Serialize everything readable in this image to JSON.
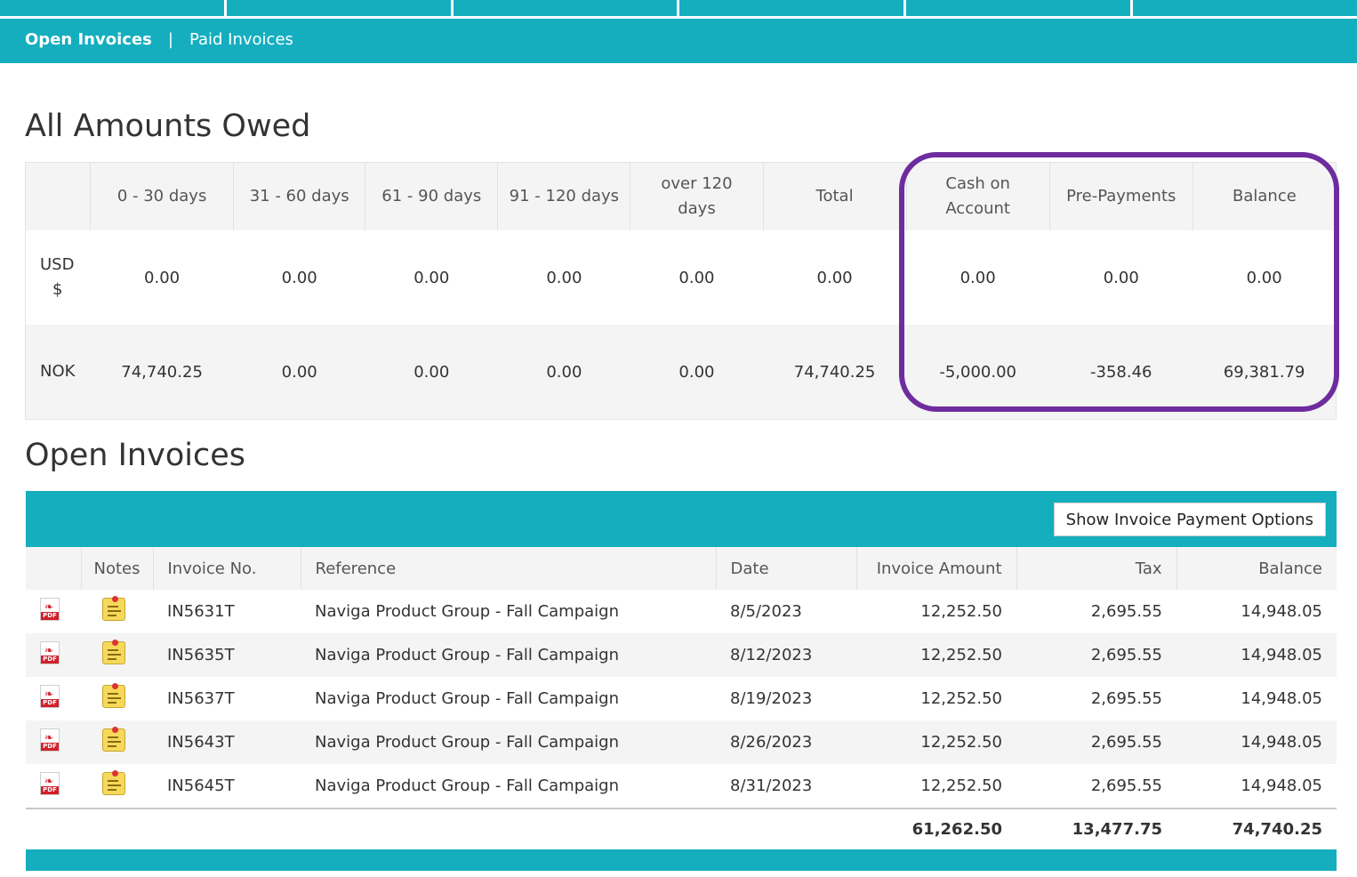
{
  "subnav": {
    "open_label": "Open Invoices",
    "separator": "|",
    "paid_label": "Paid Invoices"
  },
  "aging": {
    "title": "All Amounts Owed",
    "headers": [
      "",
      "0 - 30 days",
      "31 - 60 days",
      "61 - 90 days",
      "91 - 120 days",
      "over 120 days",
      "Total",
      "Cash on Account",
      "Pre-Payments",
      "Balance"
    ],
    "rows": [
      {
        "currency_line1": "USD",
        "currency_line2": "$",
        "values": [
          "0.00",
          "0.00",
          "0.00",
          "0.00",
          "0.00",
          "0.00",
          "0.00",
          "0.00",
          "0.00"
        ]
      },
      {
        "currency_line1": "NOK",
        "currency_line2": "",
        "values": [
          "74,740.25",
          "0.00",
          "0.00",
          "0.00",
          "0.00",
          "74,740.25",
          "-5,000.00",
          "-358.46",
          "69,381.79"
        ]
      }
    ],
    "highlight_color": "#6e2c9e"
  },
  "invoices": {
    "title": "Open Invoices",
    "payment_button": "Show Invoice Payment Options",
    "headers": {
      "icon": "",
      "notes": "Notes",
      "invoice_no": "Invoice No.",
      "reference": "Reference",
      "date": "Date",
      "amount": "Invoice Amount",
      "tax": "Tax",
      "balance": "Balance"
    },
    "rows": [
      {
        "invoice_no": "IN5631T",
        "reference": "Naviga Product Group - Fall Campaign",
        "date": "8/5/2023",
        "amount": "12,252.50",
        "tax": "2,695.55",
        "balance": "14,948.05"
      },
      {
        "invoice_no": "IN5635T",
        "reference": "Naviga Product Group - Fall Campaign",
        "date": "8/12/2023",
        "amount": "12,252.50",
        "tax": "2,695.55",
        "balance": "14,948.05"
      },
      {
        "invoice_no": "IN5637T",
        "reference": "Naviga Product Group - Fall Campaign",
        "date": "8/19/2023",
        "amount": "12,252.50",
        "tax": "2,695.55",
        "balance": "14,948.05"
      },
      {
        "invoice_no": "IN5643T",
        "reference": "Naviga Product Group - Fall Campaign",
        "date": "8/26/2023",
        "amount": "12,252.50",
        "tax": "2,695.55",
        "balance": "14,948.05"
      },
      {
        "invoice_no": "IN5645T",
        "reference": "Naviga Product Group - Fall Campaign",
        "date": "8/31/2023",
        "amount": "12,252.50",
        "tax": "2,695.55",
        "balance": "14,948.05"
      }
    ],
    "totals": {
      "amount": "61,262.50",
      "tax": "13,477.75",
      "balance": "74,740.25"
    },
    "pdf_icon_label": "PDF",
    "accent_color": "#14aebf"
  }
}
